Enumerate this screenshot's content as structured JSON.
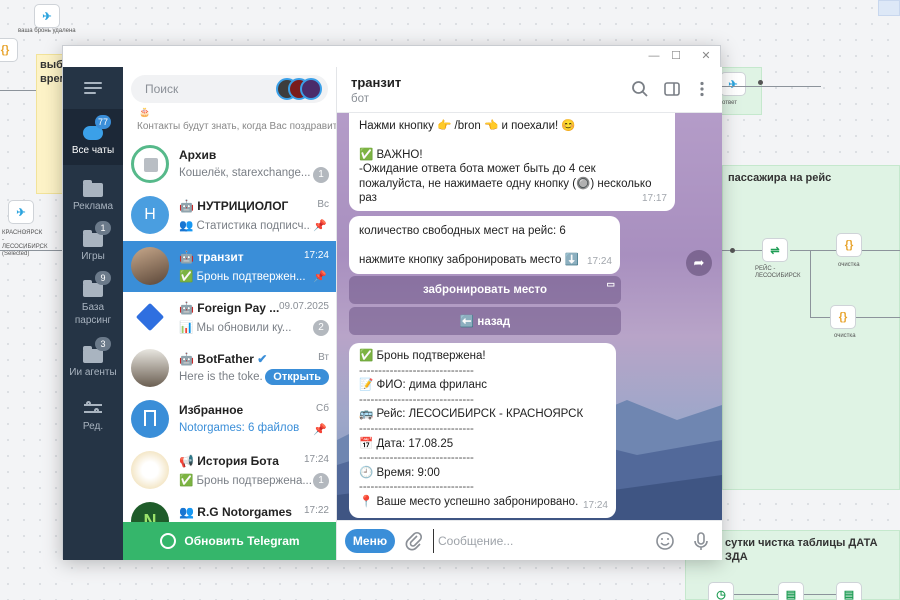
{
  "background": {
    "flow_titles": {
      "yellow": "выб\nврем",
      "green_right": "пассажира на рейс",
      "green_bottom": "сутки чистка таблицы ДАТА\nЗДА"
    },
    "node_labels": {
      "top_left": "ваша бронь удалена",
      "left_mid": "КРАСНОЯРСК - ЛЕСОСИБИРСК (Selected)",
      "right_race": "РЕЙС - ЛЕСОСИБИРСК",
      "right_clean": "очистка",
      "right_clean2": "очистка",
      "right_top": "ответ"
    }
  },
  "window": {
    "controls": {
      "minimize": "—",
      "maximize": "☐",
      "close": "✕"
    }
  },
  "nav": {
    "items": [
      {
        "label": "Все чаты",
        "badge": "77",
        "icon": "chat-bubbles-icon"
      },
      {
        "label": "Реклама",
        "badge": "",
        "icon": "folder-icon"
      },
      {
        "label": "Игры",
        "badge": "1",
        "icon": "folder-icon"
      },
      {
        "label": "База парсинг",
        "badge": "9",
        "icon": "folder-icon"
      },
      {
        "label": "Ии агенты",
        "badge": "3",
        "icon": "folder-icon"
      },
      {
        "label": "Ред.",
        "badge": "",
        "icon": "sliders-icon"
      }
    ]
  },
  "search": {
    "placeholder": "Поиск"
  },
  "birthday_notice": "Контакты будут знать, когда Вас поздравить",
  "chats": [
    {
      "name": "Архив",
      "time": "",
      "message": "Кошелёк, starexchange...",
      "badge": "1",
      "pinned": false
    },
    {
      "name": "НУТРИЦИОЛОГ",
      "time": "Вс",
      "message": "Статистика подписч...",
      "badge": "",
      "pinned": true
    },
    {
      "name": "транзит",
      "time": "17:24",
      "message": "✅ Бронь подтвержен...",
      "badge": "",
      "pinned": true
    },
    {
      "name": "Foreign Pay ...",
      "time": "09.07.2025",
      "message": "Мы обновили ку...",
      "badge": "2",
      "pinned": false
    },
    {
      "name": "BotFather",
      "time": "Вт",
      "message": "Here is the toke...",
      "badge": "",
      "pinned": false,
      "action": "Открыть"
    },
    {
      "name": "Избранное",
      "time": "Сб",
      "message": "Notorgames: 6 файлов",
      "badge": "",
      "pinned": true
    },
    {
      "name": "История Бота",
      "time": "17:24",
      "message": "✅ Бронь подтвержена...",
      "badge": "1",
      "pinned": false
    },
    {
      "name": "R.G Notorgames",
      "time": "17:22",
      "message": "",
      "badge": "",
      "pinned": false
    }
  ],
  "update_button": "Обновить Telegram",
  "chat": {
    "title": "транзит",
    "subtitle": "бот",
    "messages": [
      {
        "lines": [
          "Нажми кнопку 👉 /bron 👈 и поехали! 😊",
          "",
          "✅ ВАЖНО!",
          "-Ожидание ответа бота может быть до 4 сек",
          "пожалуйста, не нажимаете одну кнопку (🔘) несколько раз"
        ],
        "time": "17:17"
      },
      {
        "lines": [
          "количество свободных мест на рейс: 6",
          "",
          "нажмите кнопку забронировать место ⬇️"
        ],
        "time": "17:24"
      },
      {
        "lines": [
          "✅ Бронь подтвержена!",
          "------------------------------",
          "📝 ФИО: дима фриланс",
          "------------------------------",
          "🚌 Рейс: ЛЕСОСИБИРСК - КРАСНОЯРСК",
          "------------------------------",
          "📅 Дата: 17.08.25",
          "------------------------------",
          "🕘 Время: 9:00",
          "------------------------------",
          "📍 Ваше место успешно забронировано."
        ],
        "time": "17:24"
      }
    ],
    "keyboard": [
      "забронировать место",
      "⬅️ назад"
    ]
  },
  "composer": {
    "menu_label": "Меню",
    "placeholder": "Сообщение..."
  },
  "colors": {
    "accent": "#3a8ed8",
    "nav_bg": "#253445",
    "update_green": "#35b66b"
  }
}
